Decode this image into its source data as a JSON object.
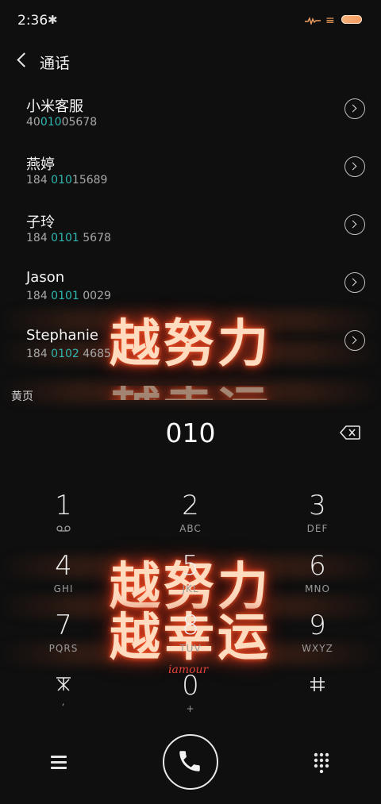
{
  "status_bar": {
    "time": "2:36",
    "bluetooth_icon": "bluetooth-icon"
  },
  "header": {
    "title": "通话"
  },
  "contacts": [
    {
      "name": "小米客服",
      "number_pre": "40",
      "number_match": "010",
      "number_post": "05678"
    },
    {
      "name": "燕婷",
      "number_pre": "184 ",
      "number_match": "010",
      "number_post": "15689"
    },
    {
      "name": "子玲",
      "number_pre": "184 ",
      "number_match": "0101",
      "number_post": " 5678"
    },
    {
      "name": "Jason",
      "number_pre": "184 ",
      "number_match": "0101",
      "number_post": " 0029"
    },
    {
      "name": "Stephanie",
      "number_pre": "184 ",
      "number_match": "0102",
      "number_post": " 4685"
    }
  ],
  "yellow_pages_label": "黄页",
  "dial_input": "010",
  "wallpaper": {
    "line1": "越努力",
    "line2": "越幸运",
    "signature": "iamour"
  },
  "keypad": [
    {
      "digit": "1",
      "letters": ""
    },
    {
      "digit": "2",
      "letters": "ABC"
    },
    {
      "digit": "3",
      "letters": "DEF"
    },
    {
      "digit": "4",
      "letters": "GHI"
    },
    {
      "digit": "5",
      "letters": "JKL"
    },
    {
      "digit": "6",
      "letters": "MNO"
    },
    {
      "digit": "7",
      "letters": "PQRS"
    },
    {
      "digit": "8",
      "letters": "TUV"
    },
    {
      "digit": "9",
      "letters": "WXYZ"
    },
    {
      "digit": "*",
      "letters": ","
    },
    {
      "digit": "0",
      "letters": "+"
    },
    {
      "digit": "#",
      "letters": ""
    }
  ],
  "colors": {
    "match_highlight": "#2fb7b0",
    "battery": "#f79b5f"
  }
}
